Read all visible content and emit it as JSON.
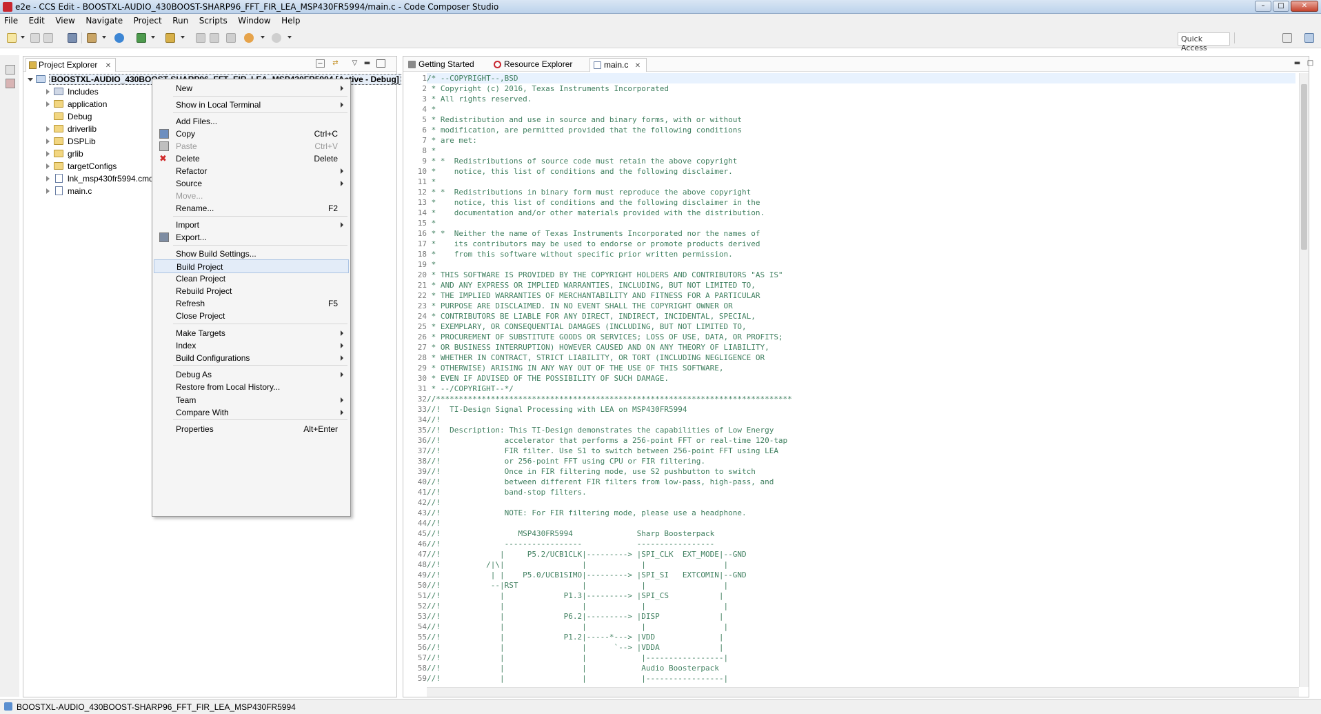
{
  "window": {
    "title": "e2e - CCS Edit - BOOSTXL-AUDIO_430BOOST-SHARP96_FFT_FIR_LEA_MSP430FR5994/main.c - Code Composer Studio"
  },
  "menubar": {
    "items": [
      "File",
      "Edit",
      "View",
      "Navigate",
      "Project",
      "Run",
      "Scripts",
      "Window",
      "Help"
    ]
  },
  "toolbar": {
    "quick_access": "Quick Access"
  },
  "explorer": {
    "tab_label": "Project Explorer",
    "root_label": "BOOSTXL-AUDIO_430BOOST-SHARP96_FFT_FIR_LEA_MSP430FR5994  [Active - Debug]",
    "items": [
      {
        "label": "Includes",
        "type": "includes"
      },
      {
        "label": "application",
        "type": "folder"
      },
      {
        "label": "Debug",
        "type": "folder"
      },
      {
        "label": "driverlib",
        "type": "folder"
      },
      {
        "label": "DSPLib",
        "type": "folder"
      },
      {
        "label": "grlib",
        "type": "folder"
      },
      {
        "label": "targetConfigs",
        "type": "folder"
      },
      {
        "label": "lnk_msp430fr5994.cmd",
        "type": "file"
      },
      {
        "label": "main.c",
        "type": "file"
      }
    ]
  },
  "context_menu": {
    "items": [
      {
        "label": "New",
        "shortcut": ""
      },
      {
        "label": "Show in Local Terminal",
        "shortcut": ""
      },
      {
        "label": "Add Files...",
        "shortcut": ""
      },
      {
        "label": "Copy",
        "shortcut": "Ctrl+C"
      },
      {
        "label": "Paste",
        "shortcut": "Ctrl+V"
      },
      {
        "label": "Delete",
        "shortcut": "Delete"
      },
      {
        "label": "Refactor",
        "shortcut": ""
      },
      {
        "label": "Source",
        "shortcut": ""
      },
      {
        "label": "Move...",
        "shortcut": ""
      },
      {
        "label": "Rename...",
        "shortcut": "F2"
      },
      {
        "label": "Import",
        "shortcut": ""
      },
      {
        "label": "Export...",
        "shortcut": ""
      },
      {
        "label": "Show Build Settings...",
        "shortcut": ""
      },
      {
        "label": "Build Project",
        "shortcut": ""
      },
      {
        "label": "Clean Project",
        "shortcut": ""
      },
      {
        "label": "Rebuild Project",
        "shortcut": ""
      },
      {
        "label": "Refresh",
        "shortcut": "F5"
      },
      {
        "label": "Close Project",
        "shortcut": ""
      },
      {
        "label": "Make Targets",
        "shortcut": ""
      },
      {
        "label": "Index",
        "shortcut": ""
      },
      {
        "label": "Build Configurations",
        "shortcut": ""
      },
      {
        "label": "Debug As",
        "shortcut": ""
      },
      {
        "label": "Restore from Local History...",
        "shortcut": ""
      },
      {
        "label": "Team",
        "shortcut": ""
      },
      {
        "label": "Compare With",
        "shortcut": ""
      },
      {
        "label": "Properties",
        "shortcut": "Alt+Enter"
      }
    ]
  },
  "editor": {
    "tabs": [
      "Getting Started",
      "Resource Explorer",
      "main.c"
    ],
    "code_lines": [
      "/* --COPYRIGHT--,BSD",
      " * Copyright (c) 2016, Texas Instruments Incorporated",
      " * All rights reserved.",
      " *",
      " * Redistribution and use in source and binary forms, with or without",
      " * modification, are permitted provided that the following conditions",
      " * are met:",
      " *",
      " * *  Redistributions of source code must retain the above copyright",
      " *    notice, this list of conditions and the following disclaimer.",
      " *",
      " * *  Redistributions in binary form must reproduce the above copyright",
      " *    notice, this list of conditions and the following disclaimer in the",
      " *    documentation and/or other materials provided with the distribution.",
      " *",
      " * *  Neither the name of Texas Instruments Incorporated nor the names of",
      " *    its contributors may be used to endorse or promote products derived",
      " *    from this software without specific prior written permission.",
      " *",
      " * THIS SOFTWARE IS PROVIDED BY THE COPYRIGHT HOLDERS AND CONTRIBUTORS \"AS IS\"",
      " * AND ANY EXPRESS OR IMPLIED WARRANTIES, INCLUDING, BUT NOT LIMITED TO,",
      " * THE IMPLIED WARRANTIES OF MERCHANTABILITY AND FITNESS FOR A PARTICULAR",
      " * PURPOSE ARE DISCLAIMED. IN NO EVENT SHALL THE COPYRIGHT OWNER OR",
      " * CONTRIBUTORS BE LIABLE FOR ANY DIRECT, INDIRECT, INCIDENTAL, SPECIAL,",
      " * EXEMPLARY, OR CONSEQUENTIAL DAMAGES (INCLUDING, BUT NOT LIMITED TO,",
      " * PROCUREMENT OF SUBSTITUTE GOODS OR SERVICES; LOSS OF USE, DATA, OR PROFITS;",
      " * OR BUSINESS INTERRUPTION) HOWEVER CAUSED AND ON ANY THEORY OF LIABILITY,",
      " * WHETHER IN CONTRACT, STRICT LIABILITY, OR TORT (INCLUDING NEGLIGENCE OR",
      " * OTHERWISE) ARISING IN ANY WAY OUT OF THE USE OF THIS SOFTWARE,",
      " * EVEN IF ADVISED OF THE POSSIBILITY OF SUCH DAMAGE.",
      " * --/COPYRIGHT--*/",
      "//******************************************************************************",
      "//!  TI-Design Signal Processing with LEA on MSP430FR5994",
      "//!",
      "//!  Description: This TI-Design demonstrates the capabilities of Low Energy",
      "//!              accelerator that performs a 256-point FFT or real-time 120-tap",
      "//!              FIR filter. Use S1 to switch between 256-point FFT using LEA",
      "//!              or 256-point FFT using CPU or FIR filtering.",
      "//!              Once in FIR filtering mode, use S2 pushbutton to switch",
      "//!              between different FIR filters from low-pass, high-pass, and",
      "//!              band-stop filters.",
      "//!",
      "//!              NOTE: For FIR filtering mode, please use a headphone.",
      "//!",
      "//!                 MSP430FR5994              Sharp Boosterpack",
      "//!              -----------------            -----------------",
      "//!             |     P5.2/UCB1CLK|---------> |SPI_CLK  EXT_MODE|--GND",
      "//!          /|\\|                 |            |                 |",
      "//!           | |    P5.0/UCB1SIMO|---------> |SPI_SI   EXTCOMIN|--GND",
      "//!           --|RST              |            |                 |",
      "//!             |             P1.3|---------> |SPI_CS           |",
      "//!             |                 |            |                 |",
      "//!             |             P6.2|---------> |DISP             |",
      "//!             |                 |            |                 |",
      "//!             |             P1.2|-----*---> |VDD              |",
      "//!             |                 |      `--> |VDDA             |",
      "//!             |                 |            |-----------------|",
      "//!             |                 |            Audio Boosterpack",
      "//!             |                 |            |-----------------|"
    ]
  },
  "statusbar": {
    "text": "BOOSTXL-AUDIO_430BOOST-SHARP96_FFT_FIR_LEA_MSP430FR5994"
  }
}
